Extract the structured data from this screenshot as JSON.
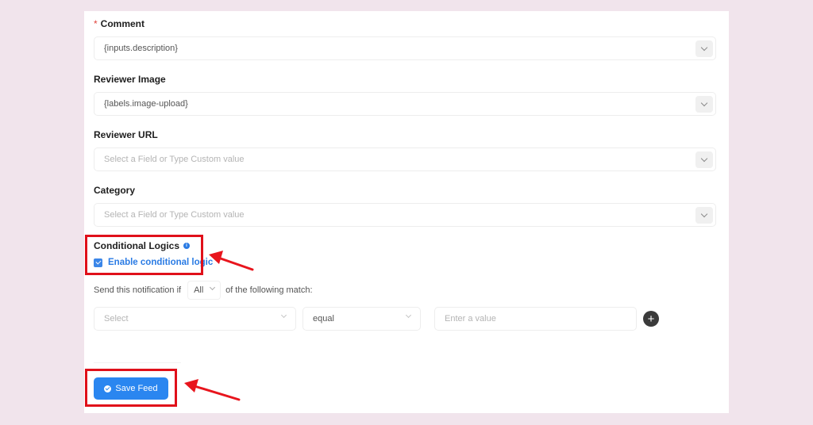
{
  "form": {
    "comment": {
      "label": "Comment",
      "required_mark": "*",
      "value": "{inputs.description}"
    },
    "reviewer_image": {
      "label": "Reviewer Image",
      "value": "{labels.image-upload}"
    },
    "reviewer_url": {
      "label": "Reviewer URL",
      "placeholder": "Select a Field or Type Custom value"
    },
    "category": {
      "label": "Category",
      "placeholder": "Select a Field or Type Custom value"
    }
  },
  "conditional": {
    "title": "Conditional Logics",
    "info_icon": "info-icon",
    "enable_label": "Enable conditional logic",
    "enabled": true,
    "send_prefix": "Send this notification if",
    "match_value": "All",
    "send_suffix": "of the following match:",
    "rule": {
      "field_placeholder": "Select",
      "operator_value": "equal",
      "value_placeholder": "Enter a value"
    },
    "add_icon": "plus-circle-icon"
  },
  "actions": {
    "save_label": "Save Feed",
    "save_icon": "check-circle-icon"
  },
  "annotations": {
    "highlight_color": "#e0101a",
    "arrow_color": "#e8151d"
  },
  "colors": {
    "accent": "#2a86f0",
    "link": "#2a7be4",
    "background": "#f1e4ec"
  }
}
